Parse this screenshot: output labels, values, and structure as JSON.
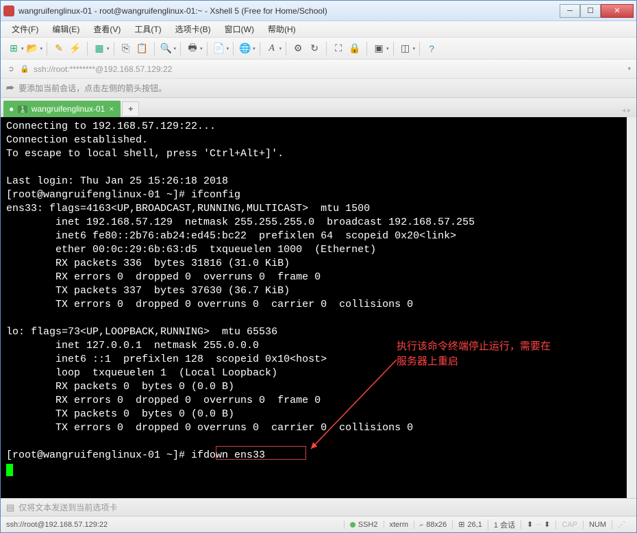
{
  "window": {
    "title": "wangruifenglinux-01 - root@wangruifenglinux-01:~ - Xshell 5 (Free for Home/School)"
  },
  "menus": {
    "file": "文件(F)",
    "edit": "编辑(E)",
    "view": "查看(V)",
    "tools": "工具(T)",
    "tab": "选项卡(B)",
    "window": "窗口(W)",
    "help": "帮助(H)"
  },
  "address": {
    "text": "ssh://root:********@192.168.57.129:22"
  },
  "infobar": {
    "text": "要添加当前会话，点击左侧的箭头按钮。"
  },
  "tab": {
    "num": "1",
    "label": "wangruifenglinux-01"
  },
  "terminal": {
    "lines": "Connecting to 192.168.57.129:22...\nConnection established.\nTo escape to local shell, press 'Ctrl+Alt+]'.\n\nLast login: Thu Jan 25 15:26:18 2018\n[root@wangruifenglinux-01 ~]# ifconfig\nens33: flags=4163<UP,BROADCAST,RUNNING,MULTICAST>  mtu 1500\n        inet 192.168.57.129  netmask 255.255.255.0  broadcast 192.168.57.255\n        inet6 fe80::2b76:ab24:ed45:bc22  prefixlen 64  scopeid 0x20<link>\n        ether 00:0c:29:6b:63:d5  txqueuelen 1000  (Ethernet)\n        RX packets 336  bytes 31816 (31.0 KiB)\n        RX errors 0  dropped 0  overruns 0  frame 0\n        TX packets 337  bytes 37630 (36.7 KiB)\n        TX errors 0  dropped 0 overruns 0  carrier 0  collisions 0\n\nlo: flags=73<UP,LOOPBACK,RUNNING>  mtu 65536\n        inet 127.0.0.1  netmask 255.0.0.0\n        inet6 ::1  prefixlen 128  scopeid 0x10<host>\n        loop  txqueuelen 1  (Local Loopback)\n        RX packets 0  bytes 0 (0.0 B)\n        RX errors 0  dropped 0  overruns 0  frame 0\n        TX packets 0  bytes 0 (0.0 B)\n        TX errors 0  dropped 0 overruns 0  carrier 0  collisions 0\n\n[root@wangruifenglinux-01 ~]# ifdown ens33",
    "annotation": "执行该命令终端停止运行，需要在\n服务器上重启"
  },
  "sendbar": {
    "placeholder": "仅将文本发送到当前选项卡"
  },
  "status": {
    "conn": "ssh://root@192.168.57.129:22",
    "ssh": "SSH2",
    "term": "xterm",
    "size": "88x26",
    "pos": "26,1",
    "sessions": "1 会话",
    "cap": "CAP",
    "num": "NUM"
  }
}
